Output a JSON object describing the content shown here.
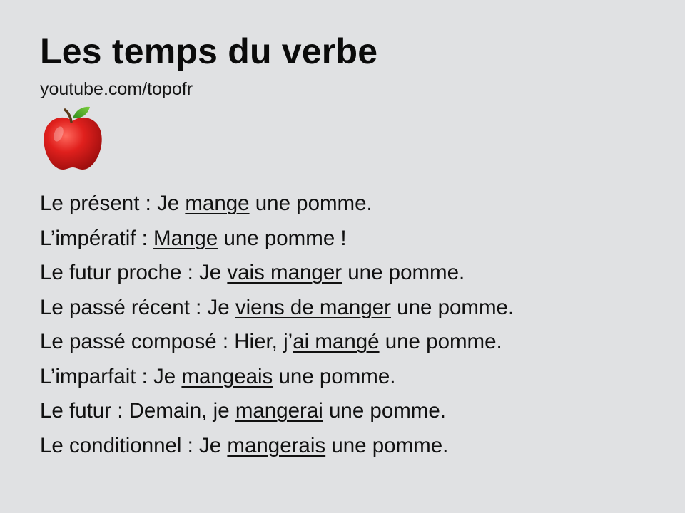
{
  "title": "Les temps du verbe",
  "subtitle": "youtube.com/topofr",
  "icon": "apple-icon",
  "colors": {
    "background": "#e0e1e3",
    "text": "#111111",
    "apple_red": "#d81c1c",
    "leaf_green": "#4cae2a"
  },
  "tenses": [
    {
      "before": "Le présent : Je ",
      "underlined": "mange",
      "after": " une pomme."
    },
    {
      "before": "L’impératif : ",
      "underlined": "Mange",
      "after": " une pomme !"
    },
    {
      "before": "Le futur proche : Je ",
      "underlined": "vais manger",
      "after": " une pomme."
    },
    {
      "before": "Le passé récent : Je ",
      "underlined": "viens de manger",
      "after": " une pomme."
    },
    {
      "before": "Le passé composé : Hier, j’",
      "underlined": "ai mangé",
      "after": " une pomme."
    },
    {
      "before": "L’imparfait : Je ",
      "underlined": "mangeais",
      "after": " une pomme."
    },
    {
      "before": "Le futur : Demain, je ",
      "underlined": "mangerai",
      "after": " une pomme."
    },
    {
      "before": "Le conditionnel : Je ",
      "underlined": "mangerais",
      "after": " une pomme."
    }
  ]
}
